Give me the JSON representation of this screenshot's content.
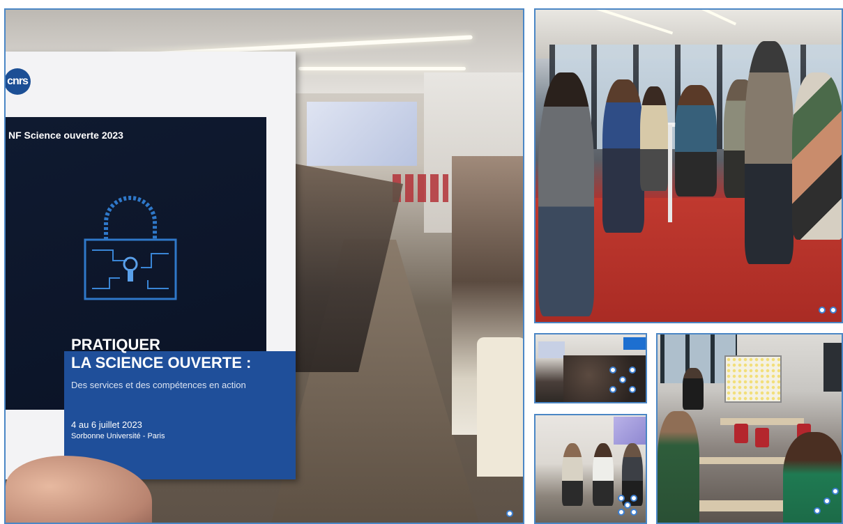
{
  "brochure": {
    "logo_text": "cnrs",
    "conference_title": "NF Science ouverte 2023",
    "headline_line1": "PRATIQUER",
    "headline_line2": "LA SCIENCE OUVERTE :",
    "subtitle": "Des services et des compétences en action",
    "dates": "4 au 6 juillet 2023",
    "venue": "Sorbonne Université - Paris"
  },
  "photos": [
    {
      "id": "lecture-hall-brochure",
      "markers": 1
    },
    {
      "id": "reception-red-floor",
      "markers": 2
    },
    {
      "id": "small-lecture",
      "markers": 5
    },
    {
      "id": "panel-speakers",
      "markers": 5
    },
    {
      "id": "workshop-room",
      "markers": 3
    }
  ],
  "colors": {
    "frame_border": "#4a86c5",
    "marker_ring": "#3d7fd0",
    "brochure_blue": "#1f4f9a",
    "brochure_dark": "#0f1a30",
    "floor_red": "#c23a33"
  }
}
